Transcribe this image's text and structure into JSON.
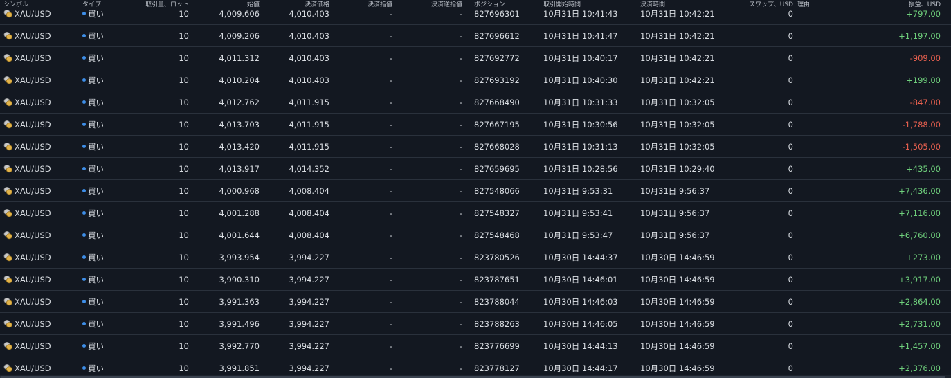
{
  "header": {
    "symbol": "シンボル",
    "type": "タイプ",
    "volume": "取引量、ロット",
    "open_price": "始値",
    "close_price": "決済価格",
    "take_profit": "決済指値",
    "stop_loss": "決済逆指値",
    "position": "ポジション",
    "open_time": "取引開始時間",
    "close_time": "決済時間",
    "swap": "スワップ、USD",
    "reason": "理由",
    "profit": "損益、USD"
  },
  "colors": {
    "background": "#131821",
    "row_divider": "#2a313c",
    "buy_dot": "#3e8ee8",
    "profit_positive": "#6fd07c",
    "profit_negative": "#e8604f"
  },
  "icons": {
    "symbol": "gold-coins-icon",
    "type": "buy-dot-icon"
  },
  "rows": [
    {
      "symbol": "XAU/USD",
      "type": "買い",
      "volume": "10",
      "open": "4,009.606",
      "close": "4,010.403",
      "tp": "-",
      "sl": "-",
      "position": "827696301",
      "open_time": "10月31日 10:41:43",
      "close_time": "10月31日 10:42:21",
      "swap": "0",
      "profit": "+797.00",
      "sign": "pos"
    },
    {
      "symbol": "XAU/USD",
      "type": "買い",
      "volume": "10",
      "open": "4,009.206",
      "close": "4,010.403",
      "tp": "-",
      "sl": "-",
      "position": "827696612",
      "open_time": "10月31日 10:41:47",
      "close_time": "10月31日 10:42:21",
      "swap": "0",
      "profit": "+1,197.00",
      "sign": "pos"
    },
    {
      "symbol": "XAU/USD",
      "type": "買い",
      "volume": "10",
      "open": "4,011.312",
      "close": "4,010.403",
      "tp": "-",
      "sl": "-",
      "position": "827692772",
      "open_time": "10月31日 10:40:17",
      "close_time": "10月31日 10:42:21",
      "swap": "0",
      "profit": "-909.00",
      "sign": "neg"
    },
    {
      "symbol": "XAU/USD",
      "type": "買い",
      "volume": "10",
      "open": "4,010.204",
      "close": "4,010.403",
      "tp": "-",
      "sl": "-",
      "position": "827693192",
      "open_time": "10月31日 10:40:30",
      "close_time": "10月31日 10:42:21",
      "swap": "0",
      "profit": "+199.00",
      "sign": "pos"
    },
    {
      "symbol": "XAU/USD",
      "type": "買い",
      "volume": "10",
      "open": "4,012.762",
      "close": "4,011.915",
      "tp": "-",
      "sl": "-",
      "position": "827668490",
      "open_time": "10月31日 10:31:33",
      "close_time": "10月31日 10:32:05",
      "swap": "0",
      "profit": "-847.00",
      "sign": "neg"
    },
    {
      "symbol": "XAU/USD",
      "type": "買い",
      "volume": "10",
      "open": "4,013.703",
      "close": "4,011.915",
      "tp": "-",
      "sl": "-",
      "position": "827667195",
      "open_time": "10月31日 10:30:56",
      "close_time": "10月31日 10:32:05",
      "swap": "0",
      "profit": "-1,788.00",
      "sign": "neg"
    },
    {
      "symbol": "XAU/USD",
      "type": "買い",
      "volume": "10",
      "open": "4,013.420",
      "close": "4,011.915",
      "tp": "-",
      "sl": "-",
      "position": "827668028",
      "open_time": "10月31日 10:31:13",
      "close_time": "10月31日 10:32:05",
      "swap": "0",
      "profit": "-1,505.00",
      "sign": "neg"
    },
    {
      "symbol": "XAU/USD",
      "type": "買い",
      "volume": "10",
      "open": "4,013.917",
      "close": "4,014.352",
      "tp": "-",
      "sl": "-",
      "position": "827659695",
      "open_time": "10月31日 10:28:56",
      "close_time": "10月31日 10:29:40",
      "swap": "0",
      "profit": "+435.00",
      "sign": "pos"
    },
    {
      "symbol": "XAU/USD",
      "type": "買い",
      "volume": "10",
      "open": "4,000.968",
      "close": "4,008.404",
      "tp": "-",
      "sl": "-",
      "position": "827548066",
      "open_time": "10月31日 9:53:31",
      "close_time": "10月31日 9:56:37",
      "swap": "0",
      "profit": "+7,436.00",
      "sign": "pos"
    },
    {
      "symbol": "XAU/USD",
      "type": "買い",
      "volume": "10",
      "open": "4,001.288",
      "close": "4,008.404",
      "tp": "-",
      "sl": "-",
      "position": "827548327",
      "open_time": "10月31日 9:53:41",
      "close_time": "10月31日 9:56:37",
      "swap": "0",
      "profit": "+7,116.00",
      "sign": "pos"
    },
    {
      "symbol": "XAU/USD",
      "type": "買い",
      "volume": "10",
      "open": "4,001.644",
      "close": "4,008.404",
      "tp": "-",
      "sl": "-",
      "position": "827548468",
      "open_time": "10月31日 9:53:47",
      "close_time": "10月31日 9:56:37",
      "swap": "0",
      "profit": "+6,760.00",
      "sign": "pos"
    },
    {
      "symbol": "XAU/USD",
      "type": "買い",
      "volume": "10",
      "open": "3,993.954",
      "close": "3,994.227",
      "tp": "-",
      "sl": "-",
      "position": "823780526",
      "open_time": "10月30日 14:44:37",
      "close_time": "10月30日 14:46:59",
      "swap": "0",
      "profit": "+273.00",
      "sign": "pos"
    },
    {
      "symbol": "XAU/USD",
      "type": "買い",
      "volume": "10",
      "open": "3,990.310",
      "close": "3,994.227",
      "tp": "-",
      "sl": "-",
      "position": "823787651",
      "open_time": "10月30日 14:46:01",
      "close_time": "10月30日 14:46:59",
      "swap": "0",
      "profit": "+3,917.00",
      "sign": "pos"
    },
    {
      "symbol": "XAU/USD",
      "type": "買い",
      "volume": "10",
      "open": "3,991.363",
      "close": "3,994.227",
      "tp": "-",
      "sl": "-",
      "position": "823788044",
      "open_time": "10月30日 14:46:03",
      "close_time": "10月30日 14:46:59",
      "swap": "0",
      "profit": "+2,864.00",
      "sign": "pos"
    },
    {
      "symbol": "XAU/USD",
      "type": "買い",
      "volume": "10",
      "open": "3,991.496",
      "close": "3,994.227",
      "tp": "-",
      "sl": "-",
      "position": "823788263",
      "open_time": "10月30日 14:46:05",
      "close_time": "10月30日 14:46:59",
      "swap": "0",
      "profit": "+2,731.00",
      "sign": "pos"
    },
    {
      "symbol": "XAU/USD",
      "type": "買い",
      "volume": "10",
      "open": "3,992.770",
      "close": "3,994.227",
      "tp": "-",
      "sl": "-",
      "position": "823776699",
      "open_time": "10月30日 14:44:13",
      "close_time": "10月30日 14:46:59",
      "swap": "0",
      "profit": "+1,457.00",
      "sign": "pos"
    },
    {
      "symbol": "XAU/USD",
      "type": "買い",
      "volume": "10",
      "open": "3,991.851",
      "close": "3,994.227",
      "tp": "-",
      "sl": "-",
      "position": "823778127",
      "open_time": "10月30日 14:44:17",
      "close_time": "10月30日 14:46:59",
      "swap": "0",
      "profit": "+2,376.00",
      "sign": "pos"
    }
  ]
}
